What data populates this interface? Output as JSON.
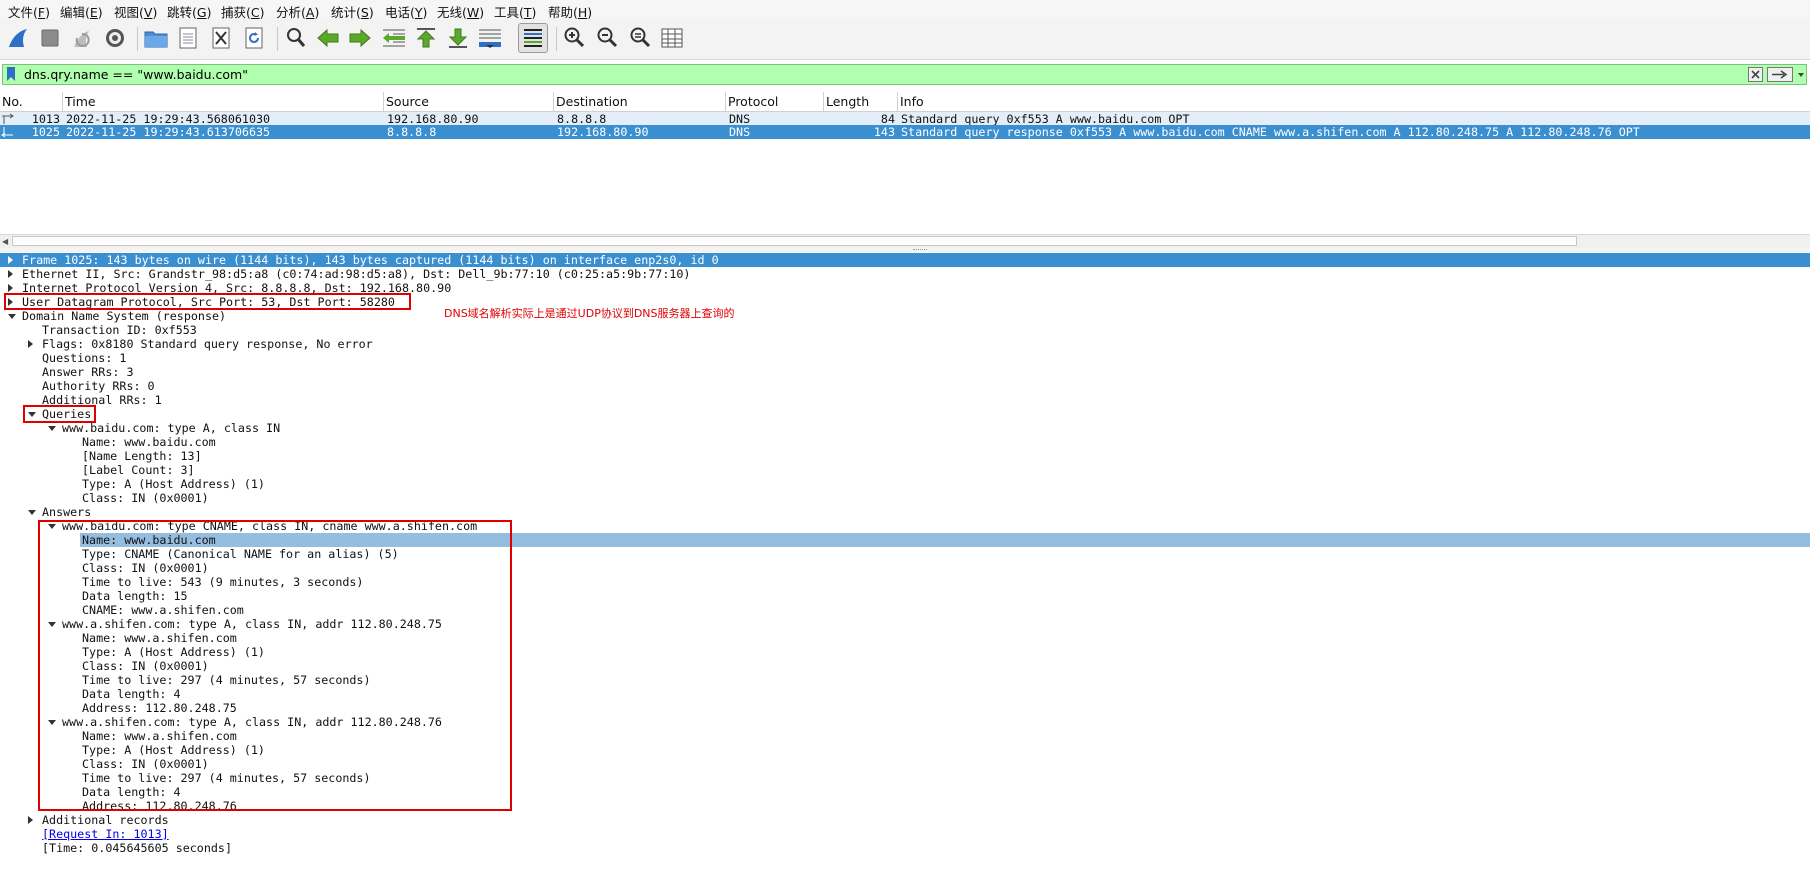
{
  "menu": [
    {
      "label": "文件(",
      "key": "F"
    },
    {
      "label": "编辑(",
      "key": "E"
    },
    {
      "label": "视图(",
      "key": "V"
    },
    {
      "label": "跳转(",
      "key": "G"
    },
    {
      "label": "捕获(",
      "key": "C"
    },
    {
      "label": "分析(",
      "key": "A"
    },
    {
      "label": "统计(",
      "key": "S"
    },
    {
      "label": "电话(",
      "key": "Y"
    },
    {
      "label": "无线(",
      "key": "W"
    },
    {
      "label": "工具(",
      "key": "T"
    },
    {
      "label": "帮助(",
      "key": "H"
    }
  ],
  "toolbar": {
    "icons": [
      "shark-fin-icon",
      "stop-icon",
      "restart-icon",
      "gear-icon",
      "open-folder-icon",
      "file-icon",
      "close-file-icon",
      "reload-icon",
      "search-icon",
      "back-arrow-icon",
      "forward-arrow-icon",
      "goto-packet-icon",
      "first-packet-icon",
      "last-packet-icon",
      "autoscroll-icon",
      "colorize-icon",
      "zoom-in-icon",
      "zoom-out-icon",
      "zoom-normal-icon",
      "resize-columns-icon"
    ],
    "accent_blue": "#2f6fc6",
    "accent_green": "#5ba82c"
  },
  "filter": {
    "value": "dns.qry.name == \"www.baidu.com\"",
    "bg_color": "#afffaf"
  },
  "packet_list": {
    "columns": [
      "No.",
      "Time",
      "Source",
      "Destination",
      "Protocol",
      "Length",
      "Info"
    ],
    "rows": [
      {
        "no": "1013",
        "time": "2022-11-25 19:29:43.568061030",
        "source": "192.168.80.90",
        "destination": "8.8.8.8",
        "protocol": "DNS",
        "length": "84",
        "info": "Standard query 0xf553 A www.baidu.com OPT"
      },
      {
        "no": "1025",
        "time": "2022-11-25 19:29:43.613706635",
        "source": "8.8.8.8",
        "destination": "192.168.80.90",
        "protocol": "DNS",
        "length": "143",
        "info": "Standard query response 0xf553 A www.baidu.com CNAME www.a.shifen.com A 112.80.248.75 A 112.80.248.76 OPT"
      }
    ]
  },
  "details": {
    "lines": [
      {
        "text": "Frame 1025: 143 bytes on wire (1144 bits), 143 bytes captured (1144 bits) on interface enp2s0, id 0",
        "level": 0,
        "exp": "right",
        "style": "frame"
      },
      {
        "text": "Ethernet II, Src: Grandstr_98:d5:a8 (c0:74:ad:98:d5:a8), Dst: Dell_9b:77:10 (c0:25:a5:9b:77:10)",
        "level": 0,
        "exp": "right"
      },
      {
        "text": "Internet Protocol Version 4, Src: 8.8.8.8, Dst: 192.168.80.90",
        "level": 0,
        "exp": "right"
      },
      {
        "text": "User Datagram Protocol, Src Port: 53, Dst Port: 58280",
        "level": 0,
        "exp": "right"
      },
      {
        "text": "Domain Name System (response)",
        "level": 0,
        "exp": "down"
      },
      {
        "text": "Transaction ID: 0xf553",
        "level": 1
      },
      {
        "text": "Flags: 0x8180 Standard query response, No error",
        "level": 1,
        "exp": "right"
      },
      {
        "text": "Questions: 1",
        "level": 1
      },
      {
        "text": "Answer RRs: 3",
        "level": 1
      },
      {
        "text": "Authority RRs: 0",
        "level": 1
      },
      {
        "text": "Additional RRs: 1",
        "level": 1
      },
      {
        "text": "Queries",
        "level": 1,
        "exp": "down"
      },
      {
        "text": "www.baidu.com: type A, class IN",
        "level": 2,
        "exp": "down"
      },
      {
        "text": "Name: www.baidu.com",
        "level": 3
      },
      {
        "text": "[Name Length: 13]",
        "level": 3
      },
      {
        "text": "[Label Count: 3]",
        "level": 3
      },
      {
        "text": "Type: A (Host Address) (1)",
        "level": 3
      },
      {
        "text": "Class: IN (0x0001)",
        "level": 3
      },
      {
        "text": "Answers",
        "level": 1,
        "exp": "down"
      },
      {
        "text": "www.baidu.com: type CNAME, class IN, cname www.a.shifen.com",
        "level": 2,
        "exp": "down"
      },
      {
        "text": "Name: www.baidu.com",
        "level": 3,
        "style": "name"
      },
      {
        "text": "Type: CNAME (Canonical NAME for an alias) (5)",
        "level": 3
      },
      {
        "text": "Class: IN (0x0001)",
        "level": 3
      },
      {
        "text": "Time to live: 543 (9 minutes, 3 seconds)",
        "level": 3
      },
      {
        "text": "Data length: 15",
        "level": 3
      },
      {
        "text": "CNAME: www.a.shifen.com",
        "level": 3
      },
      {
        "text": "www.a.shifen.com: type A, class IN, addr 112.80.248.75",
        "level": 2,
        "exp": "down"
      },
      {
        "text": "Name: www.a.shifen.com",
        "level": 3
      },
      {
        "text": "Type: A (Host Address) (1)",
        "level": 3
      },
      {
        "text": "Class: IN (0x0001)",
        "level": 3
      },
      {
        "text": "Time to live: 297 (4 minutes, 57 seconds)",
        "level": 3
      },
      {
        "text": "Data length: 4",
        "level": 3
      },
      {
        "text": "Address: 112.80.248.75",
        "level": 3
      },
      {
        "text": "www.a.shifen.com: type A, class IN, addr 112.80.248.76",
        "level": 2,
        "exp": "down"
      },
      {
        "text": "Name: www.a.shifen.com",
        "level": 3
      },
      {
        "text": "Type: A (Host Address) (1)",
        "level": 3
      },
      {
        "text": "Class: IN (0x0001)",
        "level": 3
      },
      {
        "text": "Time to live: 297 (4 minutes, 57 seconds)",
        "level": 3
      },
      {
        "text": "Data length: 4",
        "level": 3
      },
      {
        "text": "Address: 112.80.248.76",
        "level": 3
      },
      {
        "text": "Additional records",
        "level": 1,
        "exp": "right"
      },
      {
        "text": "[Request In: 1013]",
        "level": 1,
        "style": "link"
      },
      {
        "text": "[Time: 0.045645605 seconds]",
        "level": 1
      }
    ]
  },
  "annotation": {
    "note": "DNS域名解析实际上是通过UDP协议到DNS服务器上查询的",
    "color": "#e00000"
  },
  "colors": {
    "selected_row": "#3a8fd0",
    "alt_row": "#e4eef8",
    "selected_field": "#95bde0"
  }
}
